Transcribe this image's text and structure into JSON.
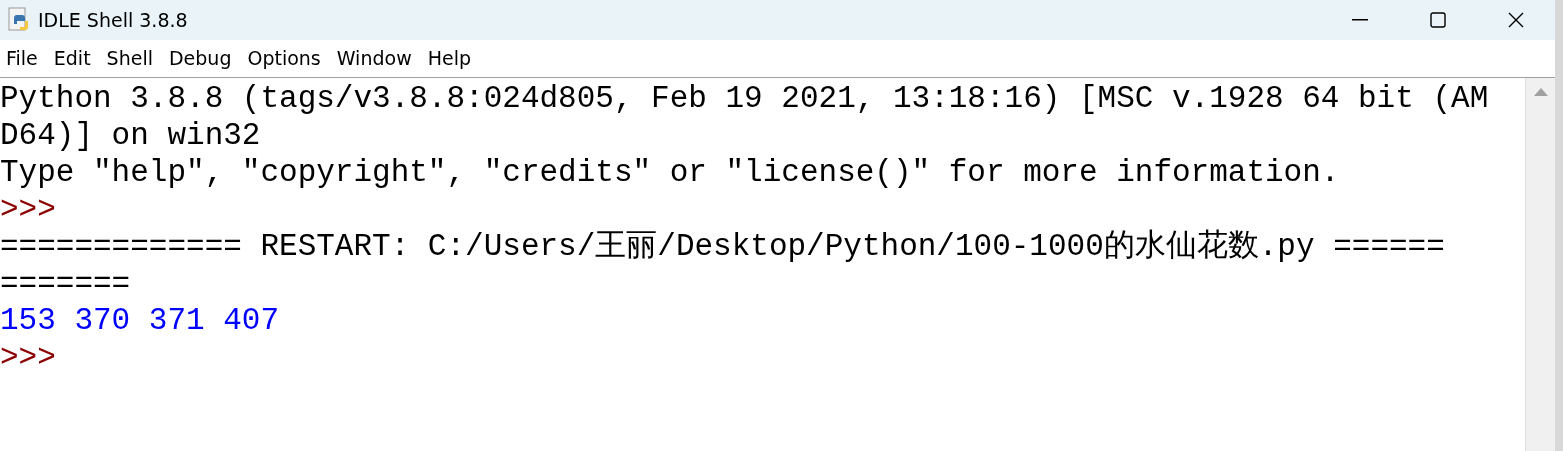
{
  "window": {
    "title": "IDLE Shell 3.8.8"
  },
  "menu": [
    "File",
    "Edit",
    "Shell",
    "Debug",
    "Options",
    "Window",
    "Help"
  ],
  "shell_lines": [
    {
      "kind": "text",
      "text": "Python 3.8.8 (tags/v3.8.8:024d805, Feb 19 2021, 13:18:16) [MSC v.1928 64 bit (AM"
    },
    {
      "kind": "text",
      "text": "D64)] on win32"
    },
    {
      "kind": "text",
      "text": "Type \"help\", \"copyright\", \"credits\" or \"license()\" for more information."
    },
    {
      "kind": "prompt",
      "text": ">>>"
    },
    {
      "kind": "text",
      "text": "============= RESTART: C:/Users/王丽/Desktop/Python/100-1000的水仙花数.py ======"
    },
    {
      "kind": "text",
      "text": "======="
    },
    {
      "kind": "output",
      "text": "153 370 371 407"
    },
    {
      "kind": "prompt",
      "text": ">>>"
    }
  ]
}
